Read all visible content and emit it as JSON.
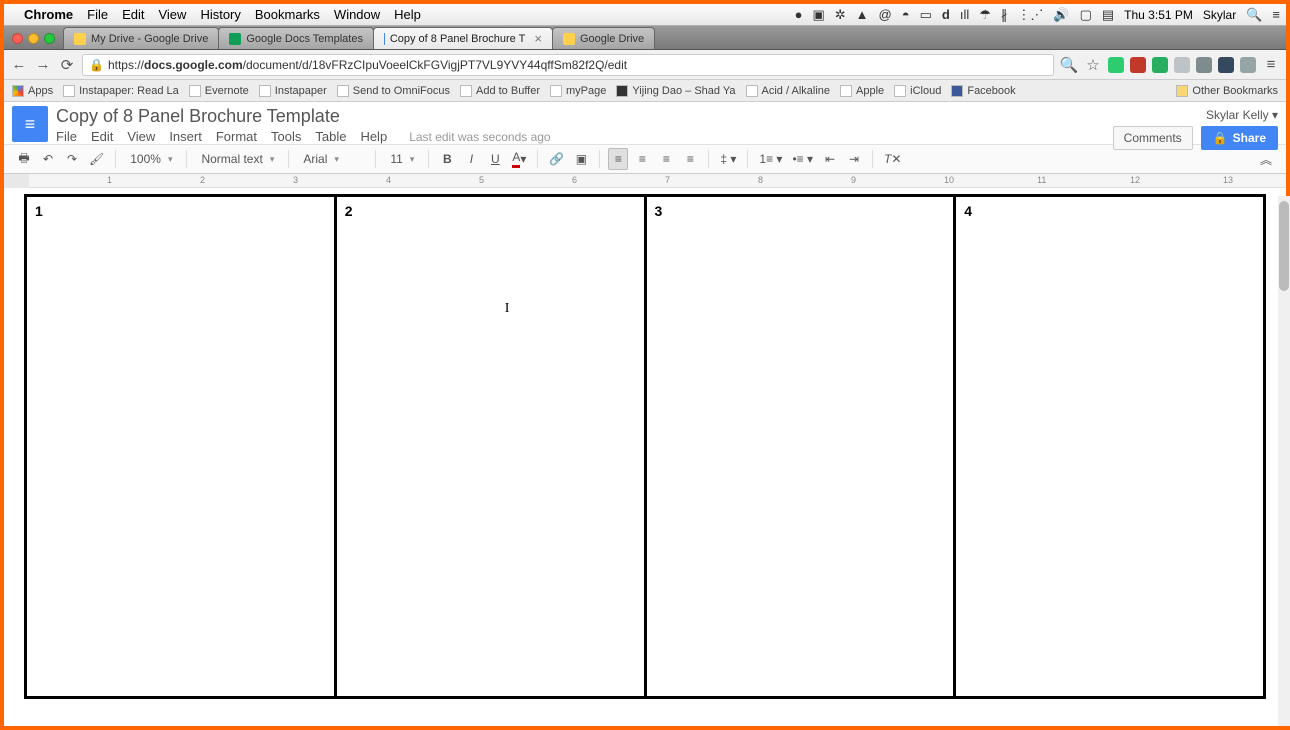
{
  "mac": {
    "app": "Chrome",
    "menus": [
      "File",
      "Edit",
      "View",
      "History",
      "Bookmarks",
      "Window",
      "Help"
    ],
    "time": "Thu 3:51 PM",
    "user": "Skylar"
  },
  "tabs": [
    {
      "label": "My Drive - Google Drive"
    },
    {
      "label": "Google Docs Templates"
    },
    {
      "label": "Copy of 8 Panel Brochure T",
      "active": true
    },
    {
      "label": "Google Drive"
    }
  ],
  "url": {
    "prefix": "https://",
    "host": "docs.google.com",
    "path": "/document/d/18vFRzCIpuVoeelCkFGVigjPT7VL9YVY44qffSm82f2Q/edit"
  },
  "bookmarks": {
    "apps": "Apps",
    "items": [
      "Instapaper: Read La",
      "Evernote",
      "Instapaper",
      "Send to OmniFocus",
      "Add to Buffer",
      "myPage",
      "Yijing Dao – Shad Ya",
      "Acid / Alkaline",
      "Apple",
      "iCloud",
      "Facebook"
    ],
    "other": "Other Bookmarks"
  },
  "doc": {
    "title": "Copy of 8 Panel Brochure Template",
    "menus": [
      "File",
      "Edit",
      "View",
      "Insert",
      "Format",
      "Tools",
      "Table",
      "Help"
    ],
    "edit_status": "Last edit was seconds ago",
    "user": "Skylar Kelly",
    "comments": "Comments",
    "share": "Share"
  },
  "toolbar": {
    "zoom": "100%",
    "style": "Normal text",
    "font": "Arial",
    "size": "11"
  },
  "ruler": [
    "1",
    "2",
    "3",
    "4",
    "5",
    "6",
    "7",
    "8",
    "9",
    "10",
    "11",
    "12",
    "13"
  ],
  "panels": [
    "1",
    "2",
    "3",
    "4"
  ]
}
